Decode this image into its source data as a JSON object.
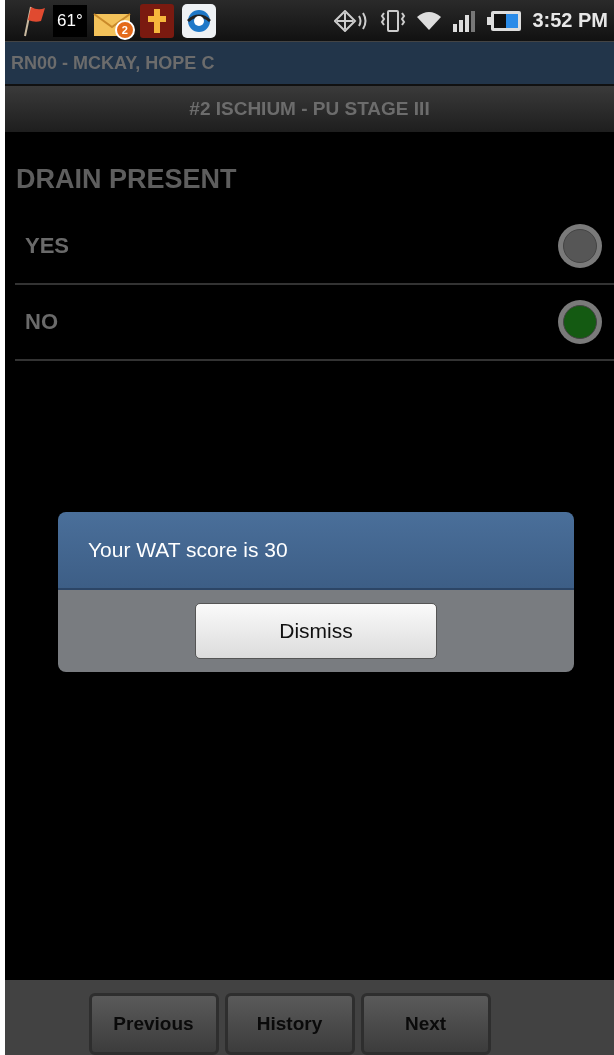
{
  "status_bar": {
    "weather": "61°",
    "mail_badge": "2",
    "time": "3:52 PM"
  },
  "patient": "RN00 - MCKAY, HOPE C",
  "title": "#2 ISCHIUM - PU STAGE III",
  "question": {
    "label": "DRAIN PRESENT",
    "options": [
      {
        "label": "YES",
        "selected": false
      },
      {
        "label": "NO",
        "selected": true
      }
    ]
  },
  "dialog": {
    "message": "Your WAT score is 30",
    "button": "Dismiss"
  },
  "nav_buttons": [
    "Previous",
    "History",
    "Next"
  ]
}
